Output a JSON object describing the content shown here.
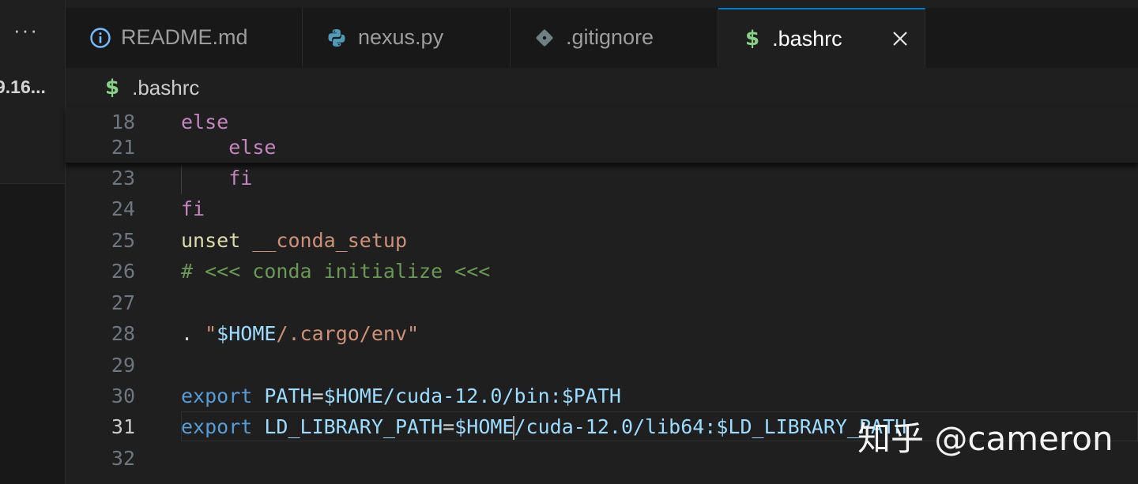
{
  "sidebar": {
    "more_label": "···",
    "version_label": "9.16..."
  },
  "tabs": [
    {
      "label": "README.md",
      "icon": "info-icon",
      "icon_color": "#75beff",
      "active": false
    },
    {
      "label": "nexus.py",
      "icon": "python-icon",
      "icon_color": "#519aba",
      "active": false
    },
    {
      "label": ".gitignore",
      "icon": "git-icon",
      "icon_color": "#6d8086",
      "active": false
    },
    {
      "label": ".bashrc",
      "icon": "shell-dollar-icon",
      "icon_color": "#89d185",
      "active": true
    }
  ],
  "tab_close_icon": "close-icon",
  "breadcrumb": {
    "icon_glyph": "$",
    "label": ".bashrc"
  },
  "sticky_lines": [
    {
      "num": "18",
      "tokens": [
        {
          "t": "else",
          "c": "kw"
        }
      ]
    },
    {
      "num": "21",
      "tokens": [
        {
          "t": "    ",
          "c": "pl"
        },
        {
          "t": "else",
          "c": "kw"
        }
      ]
    }
  ],
  "lines": [
    {
      "num": "23",
      "tokens": [
        {
          "t": "    ",
          "c": "pl"
        },
        {
          "t": "fi",
          "c": "kw"
        }
      ]
    },
    {
      "num": "24",
      "tokens": [
        {
          "t": "fi",
          "c": "kw"
        }
      ]
    },
    {
      "num": "25",
      "tokens": [
        {
          "t": "unset",
          "c": "fn"
        },
        {
          "t": " ",
          "c": "pl"
        },
        {
          "t": "__conda_setup",
          "c": "str"
        }
      ]
    },
    {
      "num": "26",
      "tokens": [
        {
          "t": "# <<< conda initialize <<<",
          "c": "cm"
        }
      ]
    },
    {
      "num": "27",
      "tokens": []
    },
    {
      "num": "28",
      "tokens": [
        {
          "t": ". ",
          "c": "pl"
        },
        {
          "t": "\"",
          "c": "str"
        },
        {
          "t": "$HOME",
          "c": "var"
        },
        {
          "t": "/.cargo/env\"",
          "c": "str"
        }
      ]
    },
    {
      "num": "29",
      "tokens": []
    },
    {
      "num": "30",
      "tokens": [
        {
          "t": "export",
          "c": "bl"
        },
        {
          "t": " ",
          "c": "pl"
        },
        {
          "t": "PATH",
          "c": "var"
        },
        {
          "t": "=",
          "c": "pl"
        },
        {
          "t": "$HOME",
          "c": "var"
        },
        {
          "t": "/cuda-12.0/bin:",
          "c": "var"
        },
        {
          "t": "$PATH",
          "c": "var"
        }
      ]
    },
    {
      "num": "31",
      "current": true,
      "tokens": [
        {
          "t": "export",
          "c": "bl"
        },
        {
          "t": " ",
          "c": "pl"
        },
        {
          "t": "LD_LIBRARY_PATH",
          "c": "var"
        },
        {
          "t": "=",
          "c": "pl"
        },
        {
          "t": "$HOME",
          "c": "var"
        },
        {
          "t": "|",
          "c": "cursor"
        },
        {
          "t": "/cuda-12.0/lib64:",
          "c": "var"
        },
        {
          "t": "$LD_LIBRARY_PATH",
          "c": "var"
        }
      ]
    },
    {
      "num": "32",
      "tokens": []
    }
  ],
  "watermark": "知乎 @cameron"
}
